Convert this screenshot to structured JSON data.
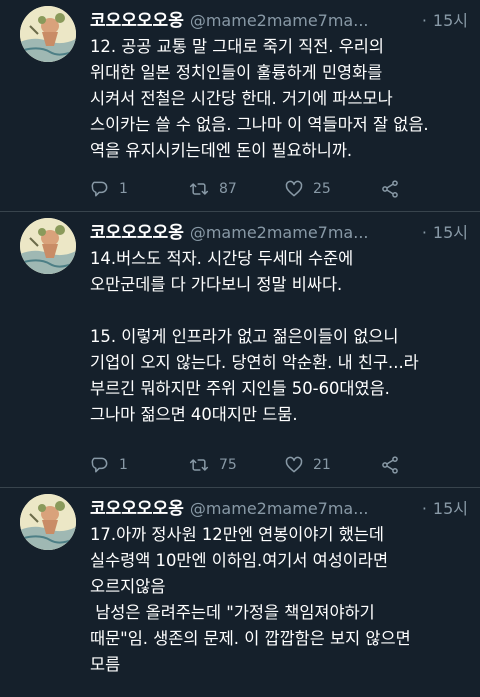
{
  "tweets": [
    {
      "name": "코오오오오옹",
      "handle": "@mame2mame7ma...",
      "dot": "·",
      "time": "15시",
      "text": "12. 공공 교통 말 그대로 죽기 직전. 우리의\n위대한 일본 정치인들이 훌륭하게 민영화를\n시켜서 전철은 시간당 한대. 거기에 파쓰모나\n스이카는 쓸 수 없음. 그나마 이 역들마저 잘 없음.\n역을 유지시키는데엔 돈이 필요하니까.",
      "reply_count": "1",
      "retweet_count": "87",
      "like_count": "25"
    },
    {
      "name": "코오오오오옹",
      "handle": "@mame2mame7ma...",
      "dot": "·",
      "time": "15시",
      "text": "14.버스도 적자. 시간당 두세대 수준에\n오만군데를 다 가다보니 정말 비싸다.\n\n15. 이렇게 인프라가 없고 젊은이들이 없으니\n기업이 오지 않는다. 당연히 악순환. 내 친구...라\n부르긴 뭐하지만 주위 지인들 50-60대였음.\n그나마 젊으면 40대지만 드뭄.",
      "reply_count": "1",
      "retweet_count": "75",
      "like_count": "21"
    },
    {
      "name": "코오오오오옹",
      "handle": "@mame2mame7ma...",
      "dot": "·",
      "time": "15시",
      "text": "17.아까 정사원 12만엔 연봉이야기 했는데\n실수령액 10만엔 이하임.여기서 여성이라면\n오르지않음\n 남성은 올려주는데 \"가정을 책임져야하기\n때문\"임. 생존의 문제. 이 깝깝함은 보지 않으면\n모름"
    }
  ],
  "icons": {
    "reply": "reply-icon",
    "retweet": "retweet-icon",
    "like": "heart-icon",
    "share": "share-icon",
    "avatar": "avatar-image"
  },
  "colors": {
    "background": "#15202b",
    "secondary_text": "#8899a6",
    "divider": "#38444d"
  }
}
